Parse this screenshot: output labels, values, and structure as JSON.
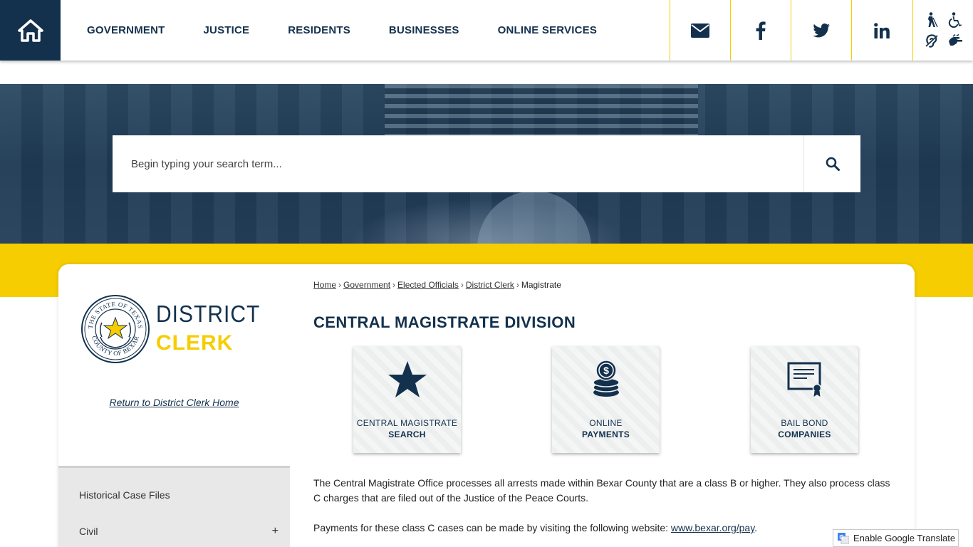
{
  "header": {
    "nav": [
      "GOVERNMENT",
      "JUSTICE",
      "RESIDENTS",
      "BUSINESSES",
      "ONLINE SERVICES"
    ],
    "social_icons": [
      "email-icon",
      "facebook-icon",
      "twitter-icon",
      "linkedin-icon"
    ],
    "accessibility_icons": [
      "low-vision-icon",
      "wheelchair-icon",
      "hearing-icon",
      "sign-language-icon"
    ],
    "colors": {
      "navy": "#13314d",
      "yellow": "#f5cd00"
    }
  },
  "search": {
    "placeholder": "Begin typing your search term..."
  },
  "sidebar": {
    "logo": {
      "seal_text_top": "THE STATE OF TEXAS",
      "seal_text_bottom": "COUNTY OF BEXAR",
      "line1": "DISTRICT",
      "line2": "CLERK"
    },
    "return_link": "Return to District Clerk Home",
    "items": [
      {
        "label": "Historical Case Files"
      },
      {
        "label": "Civil",
        "toggle": "+"
      }
    ]
  },
  "breadcrumb": {
    "items": [
      "Home",
      "Government",
      "Elected Officials",
      "District Clerk"
    ],
    "current": "Magistrate",
    "separator": "›"
  },
  "page": {
    "title": "CENTRAL MAGISTRATE DIVISION",
    "tiles": [
      {
        "line1": "CENTRAL MAGISTRATE",
        "line2": "SEARCH",
        "icon": "star-icon"
      },
      {
        "line1": "ONLINE",
        "line2": "PAYMENTS",
        "icon": "coins-icon"
      },
      {
        "line1": "BAIL BOND",
        "line2": "COMPANIES",
        "icon": "certificate-icon"
      }
    ],
    "para1": "The Central Magistrate Office processes all arrests made within Bexar County that are a class B or higher. They also process class C charges that are filed out of the Justice of the Peace Courts.",
    "para2_prefix": "Payments for these class C cases can be made by visiting the following website: ",
    "para2_link": "www.bexar.org/pay",
    "para2_suffix": "."
  },
  "translate": {
    "label": "Enable Google Translate"
  }
}
